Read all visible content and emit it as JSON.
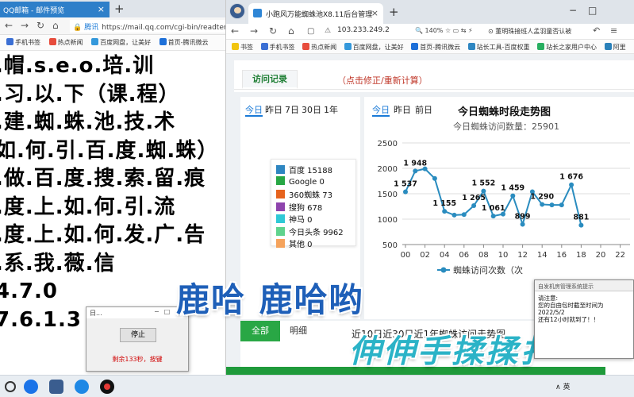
{
  "left_window": {
    "tab_title": "QQ邮箱 - 邮件预览",
    "url_site": "腾讯",
    "url": "https://mail.qq.com/cgi-bin/readtemplate",
    "bookmarks": [
      "手机书签",
      "热点新闻",
      "百度网盘，让美好",
      "首页-腾讯微云"
    ],
    "lines": [
      ".帽.s.e.o.培.训",
      ".习.以.下（课.程）",
      ".建.蜘.蛛.池.技.术",
      "如.何.引.百.度.蜘.蛛）",
      ".做.百.度.搜.索.留.痕",
      ".度.上.如.何.引.流",
      ".度.上.如.何.发.广.告",
      ".系.我.薇.信",
      "4.7.0",
      "7.6.1.3"
    ]
  },
  "timer_dialog": {
    "title": "日...",
    "stop_label": "停止",
    "message": "剩余133秒，按键"
  },
  "right_window": {
    "tab_title": "小跑风万能蜘蛛池X8.11后台管理",
    "url": "103.233.249.2",
    "zoom": "140%",
    "news": "董明珠接班人孟羽童否认被",
    "bookmarks": [
      "书签",
      "手机书签",
      "热点新闻",
      "百度网盘，让美好",
      "首页-腾讯微云",
      "站长工具-百度权重",
      "站长之家用户中心",
      "阿里"
    ]
  },
  "top_tabs": {
    "visit_label": "访问记录",
    "fix_label": "（点击修正/重新计算）"
  },
  "left_card": {
    "tabs": [
      "今日",
      "昨日",
      "7日",
      "30日",
      "1年"
    ],
    "legend": [
      {
        "label": "百度 15188",
        "color": "#2e86c1"
      },
      {
        "label": "Google 0",
        "color": "#28a745"
      },
      {
        "label": "360蜘蛛 73",
        "color": "#e6631e"
      },
      {
        "label": "搜狗 678",
        "color": "#8e44ad"
      },
      {
        "label": "神马 0",
        "color": "#2fc9d6"
      },
      {
        "label": "今日头条 9962",
        "color": "#5fd38d"
      },
      {
        "label": "其他 0",
        "color": "#f5a35c"
      }
    ]
  },
  "right_card": {
    "tabs": [
      "今日",
      "昨日",
      "前日"
    ],
    "title": "今日蜘蛛时段走势图",
    "subtitle": "今日蜘蛛访问数量：25901",
    "legend_label": "蜘蛛访问次数（次"
  },
  "chart_data": {
    "type": "line",
    "title": "今日蜘蛛时段走势图",
    "x": [
      0,
      1,
      2,
      3,
      4,
      5,
      6,
      7,
      8,
      9,
      10,
      11,
      12,
      13,
      14,
      15,
      16,
      17,
      18
    ],
    "x_tick_labels": [
      "00",
      "02",
      "04",
      "06",
      "08",
      "10",
      "12",
      "14",
      "16",
      "18",
      "20",
      "22"
    ],
    "y_ticks": [
      500,
      1000,
      1500,
      2000,
      2500
    ],
    "ylim": [
      500,
      2500
    ],
    "series": [
      {
        "name": "蜘蛛访问次数（次",
        "values": [
          1537,
          1948,
          1990,
          1800,
          1155,
          1080,
          1090,
          1265,
          1552,
          1061,
          1100,
          1459,
          899,
          1540,
          1290,
          1280,
          1280,
          1676,
          881
        ],
        "labels": {
          "0": "1 537",
          "1": "1 948",
          "4": "1 155",
          "7": "1 265",
          "8": "1 552",
          "9": "1 061",
          "11": "1 459",
          "12": "899",
          "14": "1 290",
          "17": "1 676",
          "18": "881"
        }
      }
    ],
    "color": "#2a8cbf",
    "grid": true
  },
  "bottom_card": {
    "all_label": "全部",
    "detail_label": "明细",
    "title": "近10日近30日近1年蜘蛛访问走势图"
  },
  "overlays": {
    "text1": "鹿哈 鹿哈哟",
    "text2": "伸伸手揉揉扌"
  },
  "notice": {
    "title": "自发机房管理系统提示",
    "body": "请注意:\n您的自由包时截至时间为 2022/5/2\n还有12小时就到了！！"
  },
  "taskbar": {
    "tray": "∧ 英"
  }
}
